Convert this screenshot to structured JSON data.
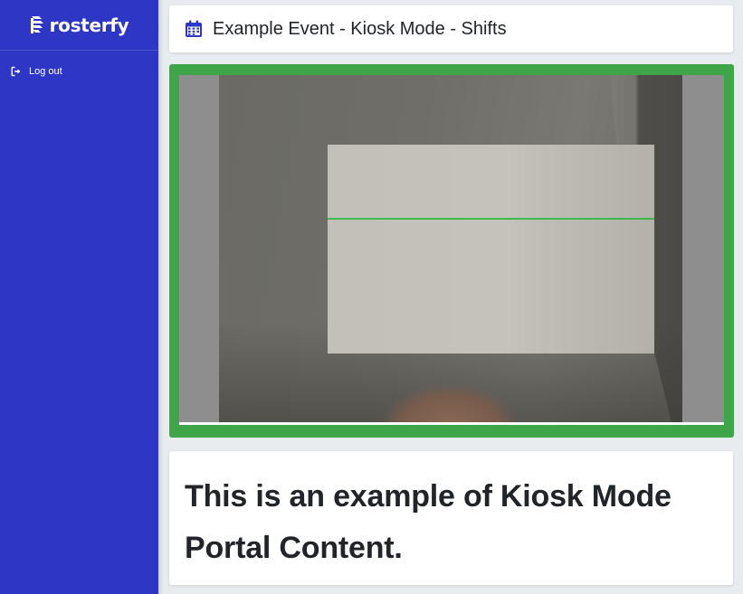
{
  "sidebar": {
    "brand": "rosterfy",
    "brand_color": "#2d36c5",
    "nav": [
      {
        "label": "Log out",
        "icon": "logout-icon"
      }
    ]
  },
  "header": {
    "icon": "calendar-icon",
    "title": "Example Event - Kiosk Mode - Shifts"
  },
  "scanner": {
    "frame_color": "#3ea649",
    "scan_line_color": "#3fb84d"
  },
  "content": {
    "heading": "This is an example of Kiosk Mode Portal Content."
  }
}
